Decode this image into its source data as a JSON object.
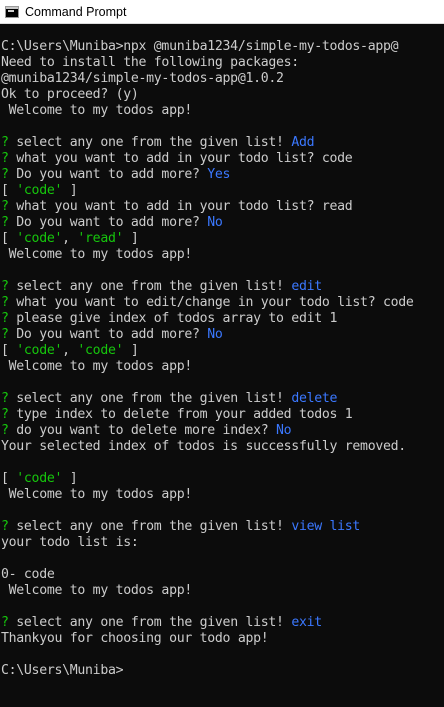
{
  "window": {
    "title": "Command Prompt",
    "app_icon": "command-prompt-icon"
  },
  "colors": {
    "background": "#0c0c0c",
    "text": "#cccccc",
    "question_mark": "#16c60c",
    "answer": "#3b78ff",
    "array_value": "#16c60c"
  },
  "console": {
    "lines": [
      [
        {
          "t": "C:\\Users\\Muniba>npx @muniba1234/simple-my-todos-app@",
          "c": "white"
        }
      ],
      [
        {
          "t": "Need to install the following packages:",
          "c": "white"
        }
      ],
      [
        {
          "t": "@muniba1234/simple-my-todos-app@1.0.2",
          "c": "white"
        }
      ],
      [
        {
          "t": "Ok to proceed? (y)",
          "c": "white"
        }
      ],
      [
        {
          "t": " Welcome to my todos app!",
          "c": "white"
        }
      ],
      [
        {
          "t": "",
          "c": "white"
        }
      ],
      [
        {
          "t": "?",
          "c": "green"
        },
        {
          "t": " select any one from the given list! ",
          "c": "white"
        },
        {
          "t": "Add",
          "c": "blue"
        }
      ],
      [
        {
          "t": "?",
          "c": "green"
        },
        {
          "t": " what you want to add in your todo list? code",
          "c": "white"
        }
      ],
      [
        {
          "t": "?",
          "c": "green"
        },
        {
          "t": " Do you want to add more? ",
          "c": "white"
        },
        {
          "t": "Yes",
          "c": "blue"
        }
      ],
      [
        {
          "t": "[ ",
          "c": "white"
        },
        {
          "t": "'code'",
          "c": "green"
        },
        {
          "t": " ]",
          "c": "white"
        }
      ],
      [
        {
          "t": "?",
          "c": "green"
        },
        {
          "t": " what you want to add in your todo list? read",
          "c": "white"
        }
      ],
      [
        {
          "t": "?",
          "c": "green"
        },
        {
          "t": " Do you want to add more? ",
          "c": "white"
        },
        {
          "t": "No",
          "c": "blue"
        }
      ],
      [
        {
          "t": "[ ",
          "c": "white"
        },
        {
          "t": "'code'",
          "c": "green"
        },
        {
          "t": ", ",
          "c": "white"
        },
        {
          "t": "'read'",
          "c": "green"
        },
        {
          "t": " ]",
          "c": "white"
        }
      ],
      [
        {
          "t": " Welcome to my todos app!",
          "c": "white"
        }
      ],
      [
        {
          "t": "",
          "c": "white"
        }
      ],
      [
        {
          "t": "?",
          "c": "green"
        },
        {
          "t": " select any one from the given list! ",
          "c": "white"
        },
        {
          "t": "edit",
          "c": "blue"
        }
      ],
      [
        {
          "t": "?",
          "c": "green"
        },
        {
          "t": " what you want to edit/change in your todo list? code",
          "c": "white"
        }
      ],
      [
        {
          "t": "?",
          "c": "green"
        },
        {
          "t": " please give index of todos array to edit 1",
          "c": "white"
        }
      ],
      [
        {
          "t": "?",
          "c": "green"
        },
        {
          "t": " Do you want to add more? ",
          "c": "white"
        },
        {
          "t": "No",
          "c": "blue"
        }
      ],
      [
        {
          "t": "[ ",
          "c": "white"
        },
        {
          "t": "'code'",
          "c": "green"
        },
        {
          "t": ", ",
          "c": "white"
        },
        {
          "t": "'code'",
          "c": "green"
        },
        {
          "t": " ]",
          "c": "white"
        }
      ],
      [
        {
          "t": " Welcome to my todos app!",
          "c": "white"
        }
      ],
      [
        {
          "t": "",
          "c": "white"
        }
      ],
      [
        {
          "t": "?",
          "c": "green"
        },
        {
          "t": " select any one from the given list! ",
          "c": "white"
        },
        {
          "t": "delete",
          "c": "blue"
        }
      ],
      [
        {
          "t": "?",
          "c": "green"
        },
        {
          "t": " type index to delete from your added todos 1",
          "c": "white"
        }
      ],
      [
        {
          "t": "?",
          "c": "green"
        },
        {
          "t": " do you want to delete more index? ",
          "c": "white"
        },
        {
          "t": "No",
          "c": "blue"
        }
      ],
      [
        {
          "t": "Your selected index of todos is successfully removed.",
          "c": "white"
        }
      ],
      [
        {
          "t": "",
          "c": "white"
        }
      ],
      [
        {
          "t": "[ ",
          "c": "white"
        },
        {
          "t": "'code'",
          "c": "green"
        },
        {
          "t": " ]",
          "c": "white"
        }
      ],
      [
        {
          "t": " Welcome to my todos app!",
          "c": "white"
        }
      ],
      [
        {
          "t": "",
          "c": "white"
        }
      ],
      [
        {
          "t": "?",
          "c": "green"
        },
        {
          "t": " select any one from the given list! ",
          "c": "white"
        },
        {
          "t": "view list",
          "c": "blue"
        }
      ],
      [
        {
          "t": "your todo list is:",
          "c": "white"
        }
      ],
      [
        {
          "t": "",
          "c": "white"
        }
      ],
      [
        {
          "t": "0- code",
          "c": "white"
        }
      ],
      [
        {
          "t": " Welcome to my todos app!",
          "c": "white"
        }
      ],
      [
        {
          "t": "",
          "c": "white"
        }
      ],
      [
        {
          "t": "?",
          "c": "green"
        },
        {
          "t": " select any one from the given list! ",
          "c": "white"
        },
        {
          "t": "exit",
          "c": "blue"
        }
      ],
      [
        {
          "t": "Thankyou for choosing our todo app!",
          "c": "white"
        }
      ],
      [
        {
          "t": "",
          "c": "white"
        }
      ],
      [
        {
          "t": "C:\\Users\\Muniba>",
          "c": "white"
        }
      ]
    ]
  }
}
